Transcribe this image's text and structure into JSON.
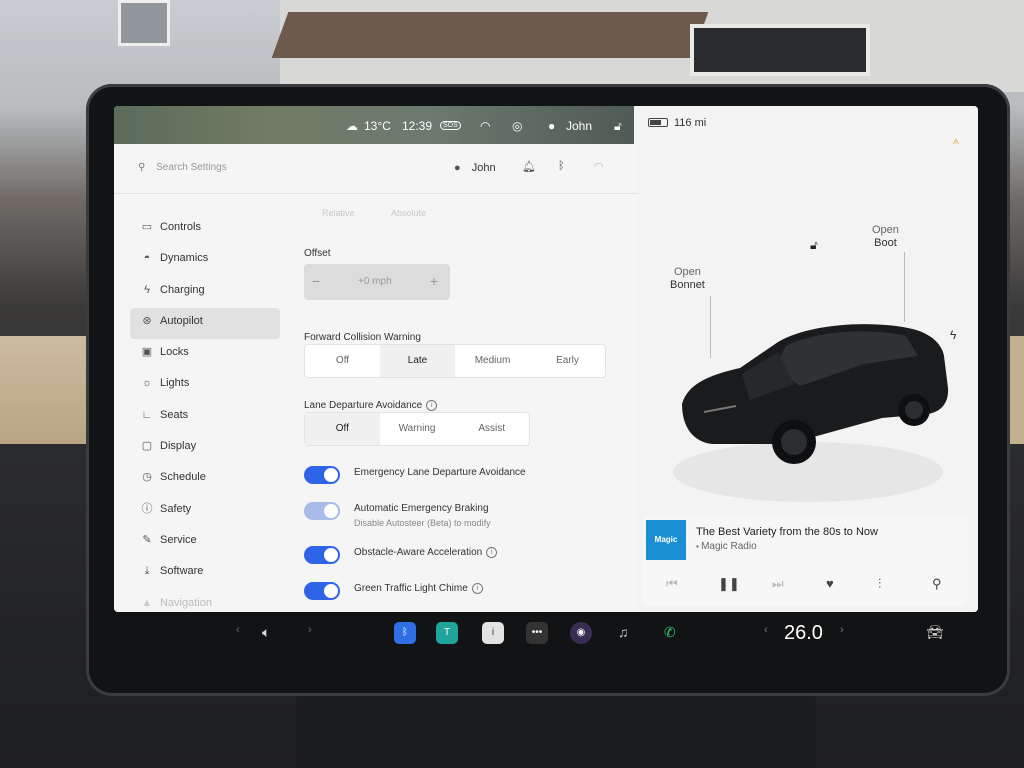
{
  "status_bar": {
    "weather": "13°C",
    "time": "12:39",
    "sos": "SOS",
    "user": "John",
    "range": "116 mi"
  },
  "settings": {
    "search_placeholder": "Search Settings",
    "profile_name": "John",
    "nav": [
      {
        "label": "Controls",
        "icon": "toggle-icon"
      },
      {
        "label": "Dynamics",
        "icon": "car-icon"
      },
      {
        "label": "Charging",
        "icon": "bolt-icon"
      },
      {
        "label": "Autopilot",
        "icon": "steering-wheel-icon"
      },
      {
        "label": "Locks",
        "icon": "lock-icon"
      },
      {
        "label": "Lights",
        "icon": "sun-icon"
      },
      {
        "label": "Seats",
        "icon": "seat-icon"
      },
      {
        "label": "Display",
        "icon": "display-icon"
      },
      {
        "label": "Schedule",
        "icon": "clock-icon"
      },
      {
        "label": "Safety",
        "icon": "safety-icon"
      },
      {
        "label": "Service",
        "icon": "wrench-icon"
      },
      {
        "label": "Software",
        "icon": "download-icon"
      },
      {
        "label": "Navigation",
        "icon": "navigation-icon"
      }
    ],
    "ghost_tabs": [
      "Relative",
      "Absolute"
    ],
    "offset": {
      "label": "Offset",
      "value": "+0 mph",
      "minus": "−",
      "plus": "+"
    },
    "fcw": {
      "label": "Forward Collision Warning",
      "options": [
        "Off",
        "Late",
        "Medium",
        "Early"
      ],
      "selected": "Late"
    },
    "lda": {
      "label": "Lane Departure Avoidance",
      "options": [
        "Off",
        "Warning",
        "Assist"
      ],
      "selected": "Off"
    },
    "toggles": [
      {
        "label": "Emergency Lane Departure Avoidance",
        "on": true,
        "enabled": true
      },
      {
        "label": "Automatic Emergency Braking",
        "sub": "Disable Autosteer (Beta) to modify",
        "on": true,
        "enabled": false
      },
      {
        "label": "Obstacle-Aware Acceleration",
        "on": true,
        "enabled": true
      },
      {
        "label": "Green Traffic Light Chime",
        "on": true,
        "enabled": true
      }
    ]
  },
  "car_panel": {
    "bonnet": {
      "line1": "Open",
      "line2": "Bonnet"
    },
    "boot": {
      "line1": "Open",
      "line2": "Boot"
    }
  },
  "media": {
    "album_art": "Magic",
    "track": "The Best Variety from the 80s to Now",
    "station": "Magic Radio"
  },
  "dock": {
    "temperature": "26.0"
  },
  "colors": {
    "toggle_on": "#2f63e8",
    "toggle_disabled": "#a9bbe9",
    "alert": "#e8a63a",
    "bluetooth": "#2f6fe6",
    "phone": "#2ecc71"
  }
}
